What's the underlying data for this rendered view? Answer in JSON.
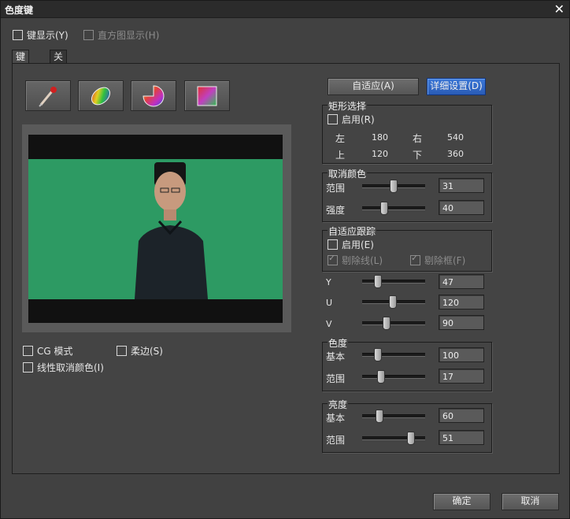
{
  "window": {
    "title": "色度键",
    "close_icon": "close-icon"
  },
  "options": {
    "show_key": "键显示(Y)",
    "show_histogram": "直方图显示(H)"
  },
  "tabs": [
    {
      "label": "键设置"
    },
    {
      "label": "关键帧设置"
    }
  ],
  "tools": [
    "eyedropper-icon",
    "color-ellipse-icon",
    "color-wheel-icon",
    "color-square-icon"
  ],
  "buttons": {
    "adaptive": "自适应(A)",
    "detail": "详细设置(D)",
    "ok": "确定",
    "cancel": "取消"
  },
  "rect_select": {
    "title": "矩形选择",
    "enable": "启用(R)",
    "left_label": "左",
    "left": "180",
    "right_label": "右",
    "right": "540",
    "top_label": "上",
    "top": "120",
    "bottom_label": "下",
    "bottom": "360"
  },
  "cancel_color": {
    "title": "取消颜色",
    "range_label": "范围",
    "range": "31",
    "strength_label": "强度",
    "strength": "40"
  },
  "adaptive_tracking": {
    "title": "自适应跟踪",
    "enable": "启用(E)",
    "remove_line": "剔除线(L)",
    "remove_frame": "剔除框(F)"
  },
  "yuv": {
    "y_label": "Y",
    "y": "47",
    "u_label": "U",
    "u": "120",
    "v_label": "V",
    "v": "90"
  },
  "hue": {
    "title": "色度",
    "base_label": "基本",
    "base": "100",
    "range_label": "范围",
    "range": "17"
  },
  "brightness": {
    "title": "亮度",
    "base_label": "基本",
    "base": "60",
    "range_label": "范围",
    "range": "51"
  },
  "bottom_options": {
    "cg_mode": "CG 模式",
    "soft_edge": "柔边(S)",
    "linear_cancel": "线性取消颜色(I)"
  }
}
